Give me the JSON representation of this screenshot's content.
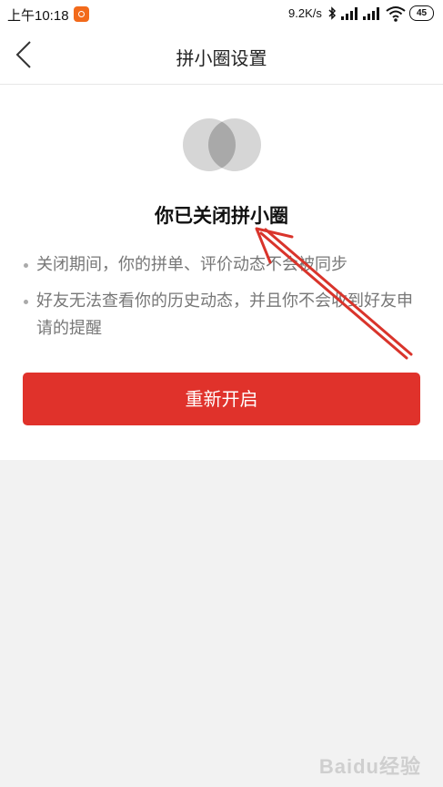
{
  "status_bar": {
    "time": "上午10:18",
    "network_speed": "9.2K/s",
    "battery": "45"
  },
  "nav": {
    "title": "拼小圈设置"
  },
  "main": {
    "status_title": "你已关闭拼小圈",
    "bullets": [
      "关闭期间，你的拼单、评价动态不会被同步",
      "好友无法查看你的历史动态，并且你不会收到好友申请的提醒"
    ],
    "reopen_button": "重新开启"
  },
  "watermark": "Baidu经验",
  "colors": {
    "accent": "#e0322b",
    "annotation_arrow": "#d9342b"
  }
}
